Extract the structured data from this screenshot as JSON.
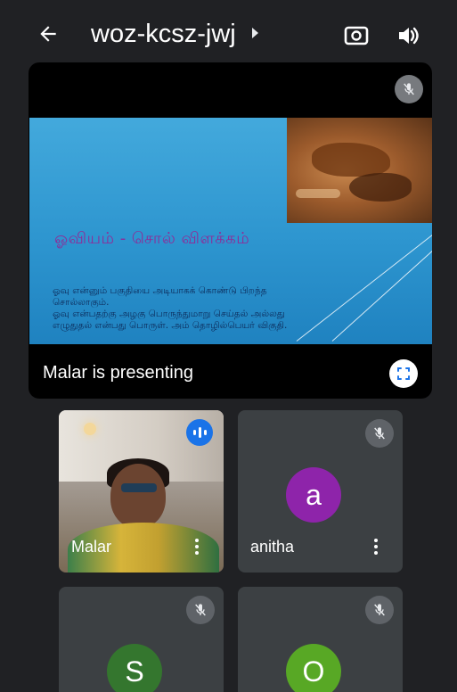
{
  "header": {
    "meeting_code": "woz-kcsz-jwj",
    "back_icon": "arrow-left-icon",
    "switch_camera_icon": "switch-camera-icon",
    "speaker_icon": "speaker-icon"
  },
  "presentation": {
    "presenting_label": "Malar is presenting",
    "slide": {
      "title": "ஓவியம் - சொல் விளக்கம்",
      "body_lines": [
        "ஓவு என்னும் பகுதியை அடியாகக் கொண்டு பிறந்த",
        "சொல்லாகும்.",
        "ஓவு என்பதற்கு அழகு பொருந்துமாறு செய்தல் அல்லது",
        "எழுதுதல் என்பது பொருள். அம் தொழில்பெயர் விகுதி."
      ]
    }
  },
  "participants": [
    {
      "name": "Malar",
      "initial": "",
      "status": "speaking",
      "avatar_color": ""
    },
    {
      "name": "anitha",
      "initial": "a",
      "status": "muted",
      "avatar_color": "#8e24aa"
    },
    {
      "name": "",
      "initial": "S",
      "status": "muted",
      "avatar_color": "#34762e"
    },
    {
      "name": "",
      "initial": "O",
      "status": "muted",
      "avatar_color": "#58a825"
    }
  ],
  "colors": {
    "background": "#202124",
    "tile": "#3c4043",
    "accent": "#1a73e8"
  }
}
